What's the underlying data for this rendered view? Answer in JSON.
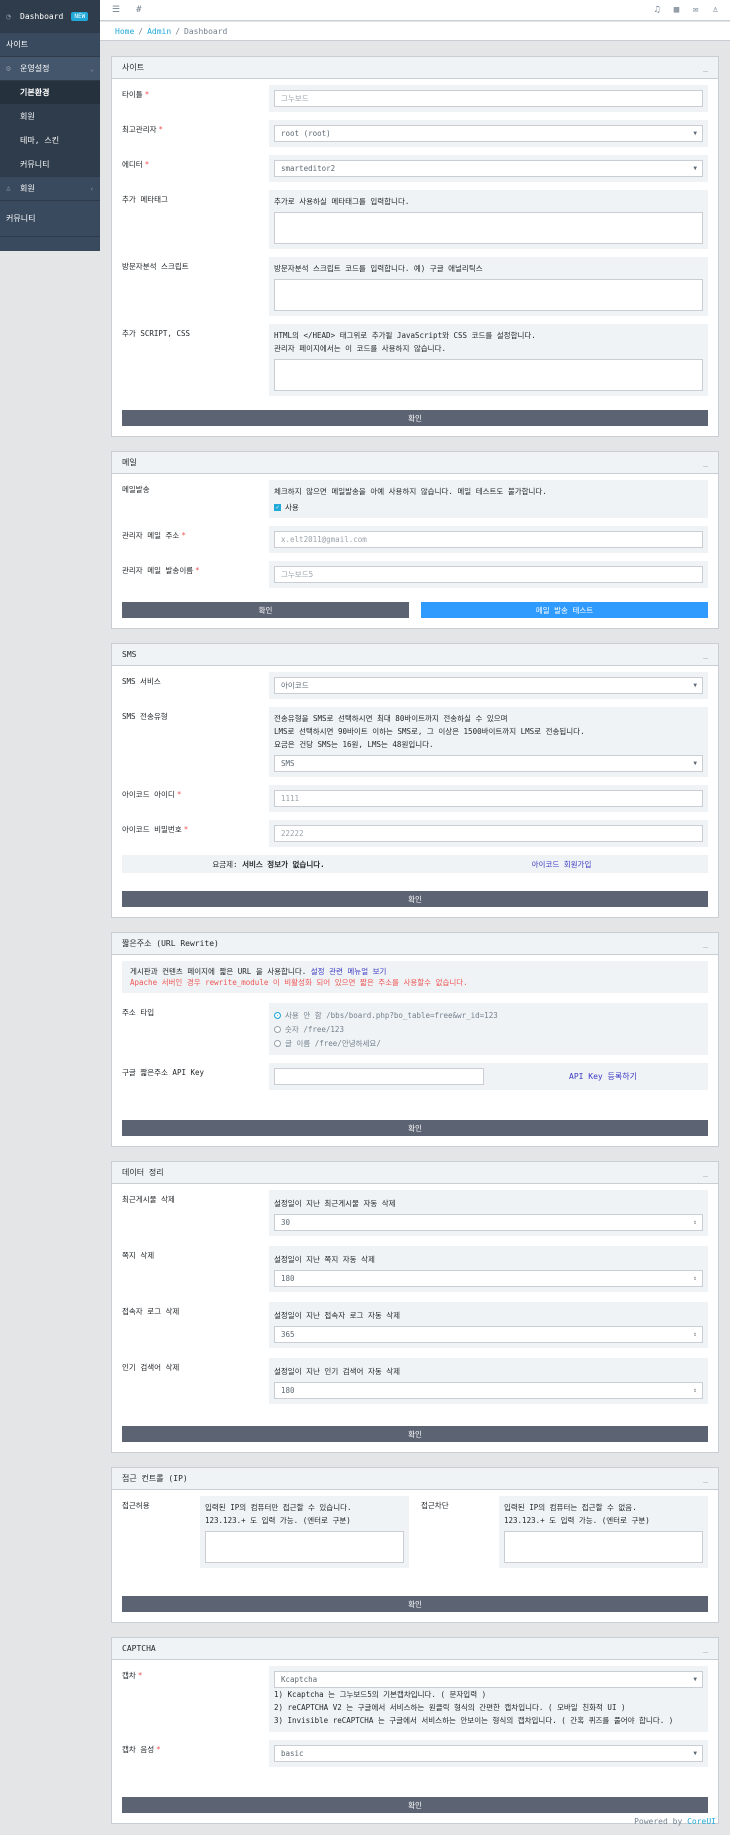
{
  "sidebar": {
    "dashboard": "Dashboard",
    "badge": "NEW",
    "site": "사이트",
    "settings": "운영설정",
    "items": [
      "기본환경",
      "회원",
      "테마, 스킨",
      "커뮤니티"
    ],
    "member": "회원",
    "community": "커뮤니티"
  },
  "topbar": {
    "hash": "#"
  },
  "breadcrumb": {
    "home": "Home",
    "admin": "Admin",
    "dashboard": "Dashboard"
  },
  "site": {
    "header": "사이트",
    "minimize": "_",
    "title_label": "타이틀",
    "title_value": "그누보드",
    "admin_label": "최고관리자",
    "admin_value": "root (root)",
    "editor_label": "에디터",
    "editor_value": "smarteditor2",
    "meta_label": "추가 메타태그",
    "meta_help": "추가로 사용하실 메타태그를 입력합니다.",
    "analytics_label": "방문자분석 스크립트",
    "analytics_help": "방문자분석 스크립트 코드를 입력합니다. 예) 구글 애널리틱스",
    "script_label": "추가 SCRIPT, CSS",
    "script_help1": "HTML의 </HEAD> 태그위로 추가될 JavaScript와 CSS 코드를 설정합니다.",
    "script_help2": "관리자 페이지에서는 이 코드를 사용하지 않습니다.",
    "confirm": "확인"
  },
  "mail": {
    "header": "메일",
    "minimize": "_",
    "send_label": "메일발송",
    "send_help": "체크하지 않으면 메일발송을 아예 사용하지 않습니다. 메일 테스트도 불가합니다.",
    "use": "사용",
    "addr_label": "관리자 메일 주소",
    "addr_ph": "x.elt2011@gmail.com",
    "name_label": "관리자 메일 발송이름",
    "name_ph": "그누보드5",
    "confirm": "확인",
    "test": "메일 발송 테스트"
  },
  "sms": {
    "header": "SMS",
    "minimize": "_",
    "service_label": "SMS 서비스",
    "service_value": "아이코드",
    "type_label": "SMS 전송유형",
    "type_help1": "전송유형을 SMS로 선택하시면 최대 80바이트까지 전송하실 수 있으며",
    "type_help2": "LMS로 선택하시면 90바이트 이하는 SMS로, 그 이상은 1500바이트까지 LMS로 전송됩니다.",
    "type_help3": "요금은 건당 SMS는 16원, LMS는 48원입니다.",
    "type_value": "SMS",
    "id_label": "아이코드 아이디",
    "id_ph": "1111",
    "pw_label": "아이코드 비밀번호",
    "pw_ph": "22222",
    "plan_label": "요금제:",
    "plan_value": "서비스 정보가 없습니다.",
    "join": "아이코드 회원가입",
    "confirm": "확인"
  },
  "url": {
    "header": "짧은주소 (URL Rewrite)",
    "minimize": "_",
    "note1": "게시판과 컨텐츠 페이지에 짧은 URL 을 사용합니다.",
    "note1_link": "설정 관련 메뉴얼 보기",
    "note2": "Apache 서버인 경우 rewrite_module 이 비활성화 되어 있으면 짧은 주소를 사용할수 없습니다.",
    "type_label": "주소 타입",
    "opt1": "사용 안 함 /bbs/board.php?bo_table=free&wr_id=123",
    "opt2": "숫자 /free/123",
    "opt3": "글 이름 /free/안녕하세요/",
    "api_label": "구글 짧은주소 API Key",
    "api_link": "API Key 등록하기",
    "confirm": "확인"
  },
  "data": {
    "header": "데이터 정리",
    "minimize": "_",
    "rows": [
      {
        "label": "최근게시물 삭제",
        "help": "설정일이 지난 최근게시물 자동 삭제",
        "value": "30"
      },
      {
        "label": "쪽지 삭제",
        "help": "설정일이 지난 쪽지 자동 삭제",
        "value": "180"
      },
      {
        "label": "접속자 로그 삭제",
        "help": "설정일이 지난 접속자 로그 자동 삭제",
        "value": "365"
      },
      {
        "label": "인기 검색어 삭제",
        "help": "설정일이 지난 인기 검색어 자동 삭제",
        "value": "180"
      }
    ],
    "confirm": "확인"
  },
  "ip": {
    "header": "접근 컨트롤 (IP)",
    "minimize": "_",
    "allow_label": "접근허용",
    "allow_help1": "입력된 IP의 컴퓨터만 접근할 수 있습니다.",
    "allow_help2": "123.123.+ 도 입력 가능. (엔터로 구분)",
    "deny_label": "접근차단",
    "deny_help1": "입력된 IP의 컴퓨터는 접근할 수 없음.",
    "deny_help2": "123.123.+ 도 입력 가능. (엔터로 구분)",
    "confirm": "확인"
  },
  "captcha": {
    "header": "CAPTCHA",
    "minimize": "_",
    "label": "캡차",
    "value": "Kcaptcha",
    "help1": "1) Kcaptcha 는 그누보드5의 기본캡차입니다. ( 문자입력 )",
    "help2": "2) reCAPTCHA V2 는 구글에서 서비스하는 원클릭 형식의 간편한 캡차입니다. ( 모바일 친화적 UI )",
    "help3": "3) Invisible reCAPTCHA 는 구글에서 서비스하는 안보이는 형식의 캡차입니다. ( 간혹 퀴즈를 풀어야 합니다. )",
    "audio_label": "캡차 음성",
    "audio_value": "basic",
    "confirm": "확인"
  },
  "footer": {
    "powered": "Powered by",
    "brand": "CoreUI"
  }
}
